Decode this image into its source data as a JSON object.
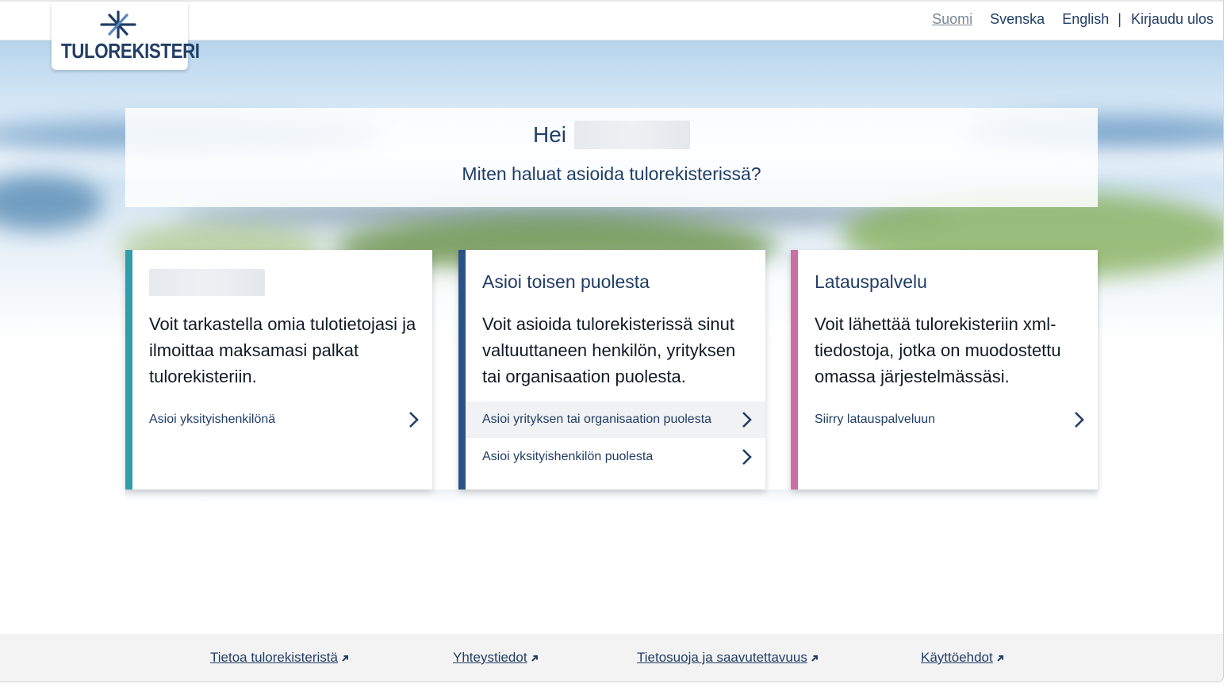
{
  "header": {
    "logo_text": "TULOREKISTERI",
    "languages": [
      "Suomi",
      "Svenska",
      "English"
    ],
    "separator": "|",
    "logout_label": "Kirjaudu ulos"
  },
  "greeting": {
    "hello": "Hei",
    "question": "Miten haluat asioida tulorekisterissä?"
  },
  "cards": [
    {
      "title": "",
      "text": "Voit tarkastella omia tulotietojasi ja ilmoittaa maksamasi palkat tulorekisteriin.",
      "links": [
        "Asioi yksityishenkilönä"
      ],
      "accent_color": "#2f9eaa"
    },
    {
      "title": "Asioi toisen puolesta",
      "text": "Voit asioida tulorekisterissä sinut valtuuttaneen henkilön, yrityksen tai organisaation puolesta.",
      "links": [
        "Asioi yrityksen tai organisaation puolesta",
        "Asioi yksityishenkilön puolesta"
      ],
      "accent_color": "#2a5289"
    },
    {
      "title": "Latauspalvelu",
      "text": "Voit lähettää tulorekisteriin xml-tiedostoja, jotka on muodostettu omassa järjestelmässäsi.",
      "links": [
        "Siirry latauspalveluun"
      ],
      "accent_color": "#cc6fa5"
    }
  ],
  "footer": {
    "links": [
      "Tietoa tulorekisteristä",
      "Yhteystiedot",
      "Tietosuoja ja saavutettavuus",
      "Käyttöehdot"
    ]
  },
  "icons": {
    "logo": "asterisk-star-icon",
    "link_arrow": "chevron-right-icon",
    "external": "external-link-arrow-icon"
  },
  "colors": {
    "brand_navy": "#213e66",
    "teal": "#2f9eaa",
    "blue": "#2a5289",
    "pink": "#cc6fa5"
  }
}
